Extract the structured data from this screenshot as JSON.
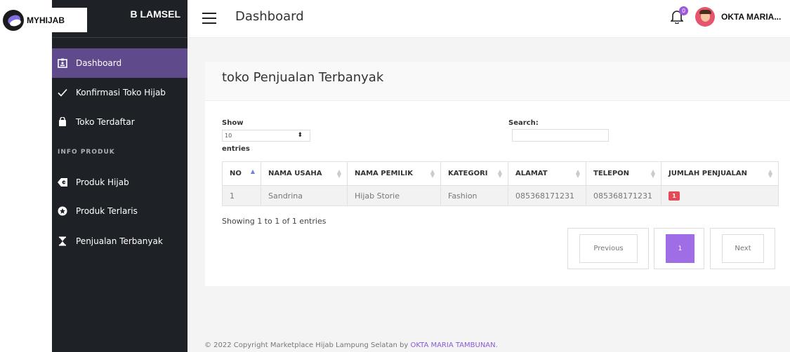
{
  "brand": {
    "name": "MYHIJAB"
  },
  "sidebar": {
    "title": "B LAMSEL",
    "items": [
      {
        "label": "Dashboard",
        "icon": "id-card-icon",
        "active": true
      },
      {
        "label": "Konfirmasi Toko Hijab",
        "icon": "check-icon"
      },
      {
        "label": "Toko Terdaftar",
        "icon": "shopping-bag-icon"
      }
    ],
    "category": "INFO PRODUK",
    "product_items": [
      {
        "label": "Produk Hijab",
        "icon": "product-icon"
      },
      {
        "label": "Produk Terlaris",
        "icon": "star-badge-icon"
      },
      {
        "label": "Penjualan Terbanyak",
        "icon": "hourglass-icon"
      }
    ]
  },
  "topbar": {
    "title": "Dashboard",
    "notification_count": "0",
    "user_name": "OKTA MARIA..."
  },
  "card": {
    "title": "toko Penjualan Terbanyak",
    "show_label": "Show",
    "entries_value": "10",
    "entries_label": "entries",
    "search_label": "Search:",
    "search_value": ""
  },
  "table": {
    "columns": [
      "NO",
      "NAMA USAHA",
      "NAMA PEMILIK",
      "KATEGORI",
      "ALAMAT",
      "TELEPON",
      "JUMLAH PENJUALAN"
    ],
    "rows": [
      [
        "1",
        "Sandrina",
        "Hijab Storie",
        "Fashion",
        "085368171231",
        "085368171231",
        "1"
      ]
    ],
    "info": "Showing 1 to 1 of 1 entries"
  },
  "pagination": {
    "previous": "Previous",
    "page": "1",
    "next": "Next"
  },
  "footer": {
    "text": "© 2022 Copyright Marketplace Hijab Lampung Selatan by ",
    "link": "OKTA MARIA TAMBUNAN."
  },
  "colors": {
    "sidebar_bg": "#1e2227",
    "active_item": "#5f4a8b",
    "accent_purple": "#9f6ee6",
    "badge_red": "#e84a55"
  }
}
